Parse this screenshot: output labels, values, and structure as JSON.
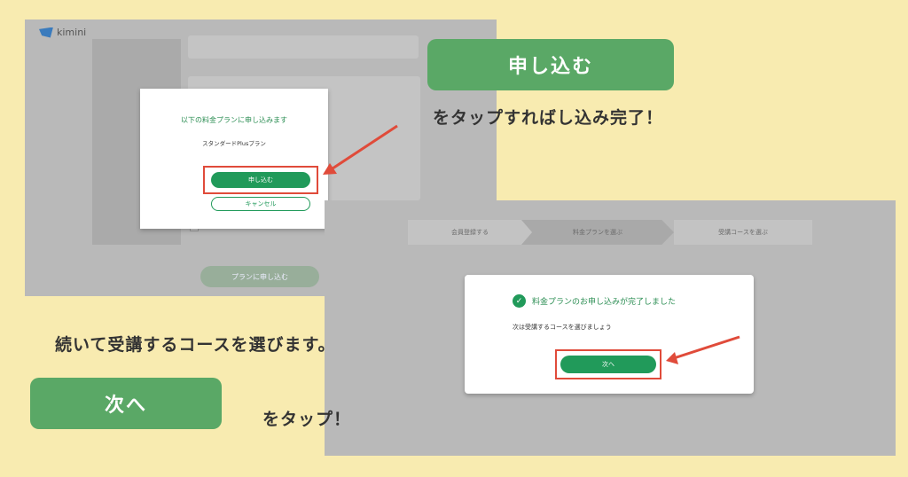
{
  "screen1": {
    "logo": "kimini",
    "modal_title": "以下の料金プランに申し込みます",
    "plan_name": "スタンダードPlusプラン",
    "apply_button": "申し込む",
    "cancel_button": "キャンセル",
    "bg_apply_button": "プランに申し込む"
  },
  "callout_apply": {
    "button": "申し込む",
    "text": "をタップすればし込み完了！"
  },
  "screen2": {
    "steps": [
      "会員登録する",
      "料金プランを選ぶ",
      "受講コースを選ぶ"
    ],
    "modal_title": "料金プランのお申し込みが完了しました",
    "modal_sub": "次は受講するコースを選びましょう",
    "next_button": "次へ"
  },
  "callout_next": {
    "intro": "続いて受講するコースを選びます。",
    "button": "次へ",
    "text": "をタップ！"
  },
  "colors": {
    "background": "#f8ebb0",
    "accent_green": "#5aa866",
    "button_green": "#219a5a",
    "highlight_red": "#e04b3a"
  }
}
